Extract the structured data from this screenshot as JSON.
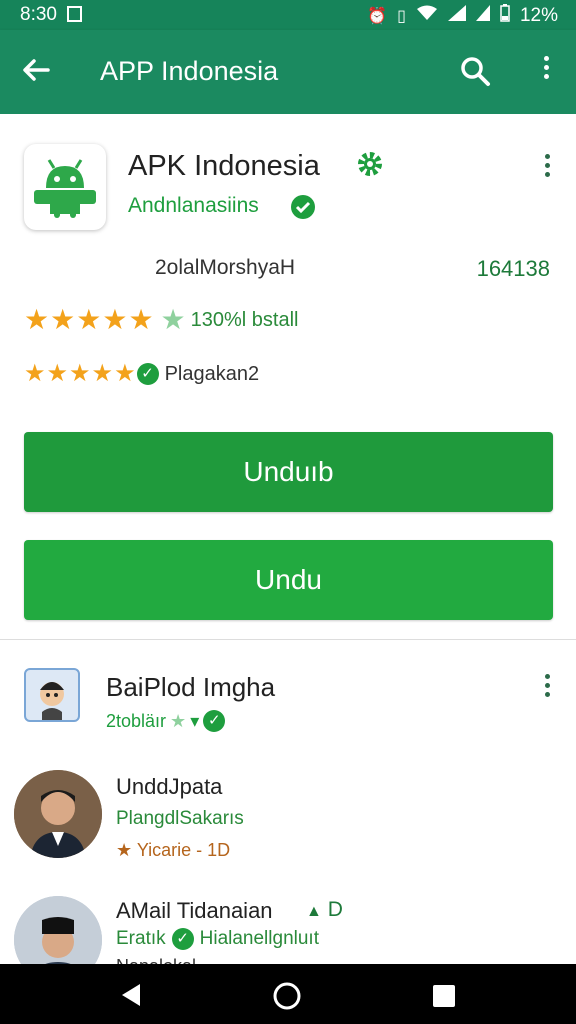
{
  "status_bar": {
    "time": "8:30",
    "battery": "12%",
    "icons": [
      "alarm-icon",
      "vibrate-icon",
      "wifi-icon",
      "signal-icon",
      "signal-icon",
      "battery-icon"
    ]
  },
  "app_bar": {
    "title": "APP Indonesia",
    "icons": [
      "back-arrow-icon",
      "search-icon",
      "more-vert-icon"
    ]
  },
  "app_card": {
    "name": "APK Indonesia",
    "developer": "Andnlanasiins",
    "meta_left": "2olalMorshyaH",
    "meta_right": "164138",
    "rating_text": "130%l bstall",
    "rating2_text": "Plagakan2",
    "button_primary": "Unduıb",
    "button_secondary": "Undu",
    "colors": {
      "primary_green": "#1f9a3c",
      "header_green": "#1b8a60",
      "star_orange": "#f3a21b"
    }
  },
  "section": {
    "title": "BaiPlod Imgha",
    "subtitle": "2tobläır",
    "items": [
      {
        "name": "UnddJpata",
        "description": "PlangdlSakarıs",
        "meta": "Yicarie - 1D"
      },
      {
        "name": "AMail Tidanaian",
        "badge": "D",
        "description": "Eratık",
        "description2": "Hialanellgnluıt",
        "meta": "Nanalokal"
      }
    ]
  }
}
